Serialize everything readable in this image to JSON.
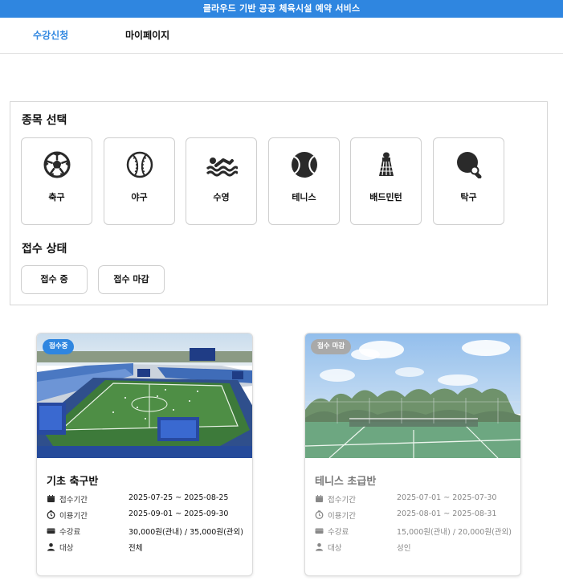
{
  "banner": {
    "title": "클라우드 기반 공공 체육시설 예약 서비스",
    "color": "#2f86e0"
  },
  "nav": {
    "tabs": [
      {
        "label": "수강신청",
        "active": true
      },
      {
        "label": "마이페이지",
        "active": false
      }
    ]
  },
  "filter": {
    "sports_heading": "종목 선택",
    "sports": [
      {
        "label": "축구",
        "icon": "soccer-ball-icon"
      },
      {
        "label": "야구",
        "icon": "baseball-icon"
      },
      {
        "label": "수영",
        "icon": "swimming-icon"
      },
      {
        "label": "테니스",
        "icon": "tennis-ball-icon"
      },
      {
        "label": "배드민턴",
        "icon": "shuttlecock-icon"
      },
      {
        "label": "탁구",
        "icon": "ping-pong-icon"
      }
    ],
    "status_heading": "접수 상태",
    "statuses": [
      "접수 중",
      "접수 마감"
    ]
  },
  "cards": [
    {
      "badge": "접수중",
      "badge_color": "#2f86e0",
      "title": "기초 축구반",
      "rows": [
        {
          "icon": "calendar-icon",
          "key": "접수기간",
          "value": "2025-07-25 ~ 2025-08-25"
        },
        {
          "icon": "clock-icon",
          "key": "이용기간",
          "value": "2025-09-01 ~ 2025-09-30"
        },
        {
          "icon": "card-icon",
          "key": "수강료",
          "value": "30,000원(관내) / 35,000원(관외)"
        },
        {
          "icon": "person-icon",
          "key": "대상",
          "value": "전체"
        }
      ]
    },
    {
      "badge": "접수 마감",
      "badge_color": "#a9a9a9",
      "title": "테니스 초급반",
      "rows": [
        {
          "icon": "calendar-icon",
          "key": "접수기간",
          "value": "2025-07-01 ~ 2025-07-30"
        },
        {
          "icon": "clock-icon",
          "key": "이용기간",
          "value": "2025-08-01 ~ 2025-08-31"
        },
        {
          "icon": "card-icon",
          "key": "수강료",
          "value": "15,000원(관내) / 20,000원(관외)"
        },
        {
          "icon": "person-icon",
          "key": "대상",
          "value": "성인"
        }
      ]
    }
  ]
}
